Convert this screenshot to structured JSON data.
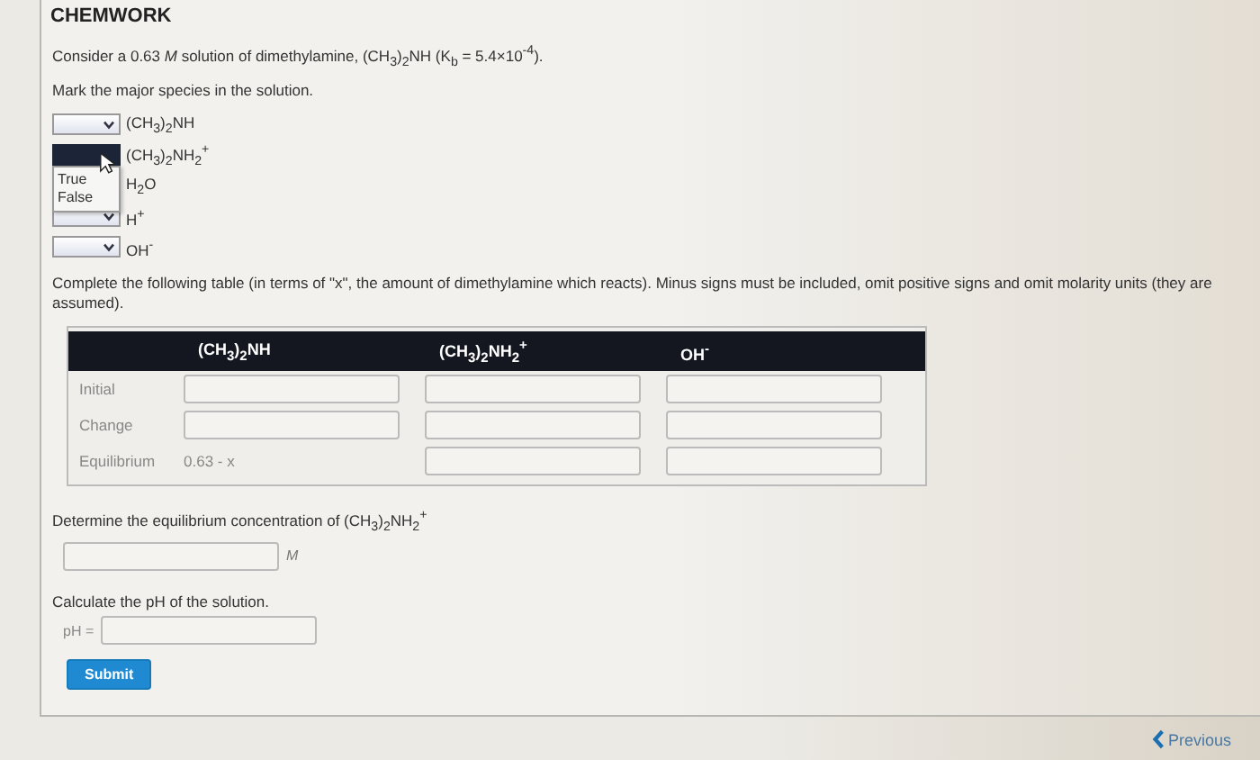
{
  "header": {
    "title": "CHEMWORK"
  },
  "question": "Consider a 0.63 *M* solution of dimethylamine, (CH$_{3}$)$_{2}$NH (K$_{b}$ = 5.4×10$^{-4}$).",
  "species_prompt": "Mark the major species in the solution.",
  "species": [
    {
      "formula": "(CH$_{3}$)$_{2}$NH",
      "expanded": false
    },
    {
      "formula": "(CH$_{3}$)$_{2}$NH$_{2}$$^{+}$",
      "expanded": true,
      "options": [
        "True",
        "False"
      ]
    },
    {
      "formula": "H$_{2}$O"
    },
    {
      "formula": "H$^{+}$",
      "expanded": false
    },
    {
      "formula": "OH$^{-}$",
      "expanded": false
    }
  ],
  "table_prompt": "Complete the following table (in terms of \"x\", the amount of dimethylamine which reacts). Minus signs must be included, omit positive signs and omit molarity units (they are assumed).",
  "table": {
    "columns": [
      "(CH$_{3}$)$_{2}$NH",
      "(CH$_{3}$)$_{2}$NH$_{2}$$^{+}$",
      "OH$^{-}$"
    ],
    "rows": [
      {
        "label": "Initial",
        "cells": [
          {
            "kind": "input"
          },
          {
            "kind": "input"
          },
          {
            "kind": "input"
          }
        ]
      },
      {
        "label": "Change",
        "cells": [
          {
            "kind": "input"
          },
          {
            "kind": "input"
          },
          {
            "kind": "input"
          }
        ]
      },
      {
        "label": "Equilibrium",
        "cells": [
          {
            "kind": "text",
            "value": "0.63 - x"
          },
          {
            "kind": "input"
          },
          {
            "kind": "input"
          }
        ]
      }
    ]
  },
  "concentration": {
    "prompt": "Determine the equilibrium concentration of (CH$_{3}$)$_{2}$NH$_{2}$$^{+}$",
    "unit": "M"
  },
  "ph": {
    "prompt": "Calculate the pH of the solution.",
    "label": "pH ="
  },
  "submit": "Submit",
  "previous": "Previous"
}
